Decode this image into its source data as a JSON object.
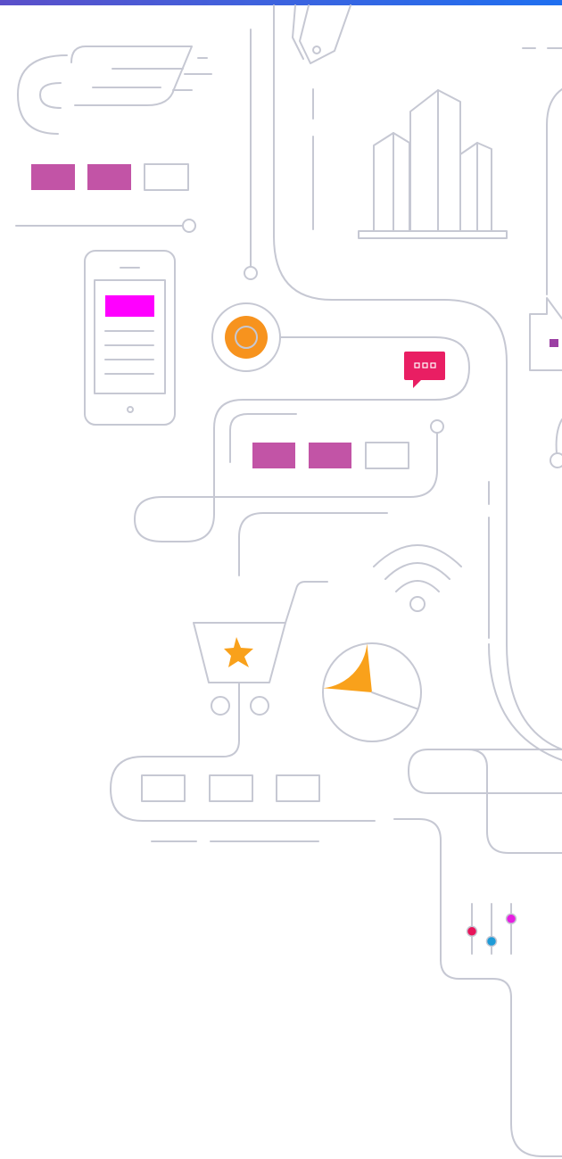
{
  "colors": {
    "line": "#c6c8d3",
    "top_bar_start": "#5b4fc9",
    "top_bar_end": "#1f6ff0",
    "magenta_block": "#c254a6",
    "phone_highlight": "#ff00ff",
    "orange": "#f7931e",
    "pie_slice": "#f9a11b",
    "chat_bubble": "#e91e63",
    "slider_knob_red": "#e8145a",
    "slider_knob_blue": "#1e9bd7",
    "slider_knob_magenta": "#e61fe0",
    "small_square": "#9b3fa3"
  },
  "icons": [
    "winged-speed-icon",
    "mobile-phone-icon",
    "city-buildings-icon",
    "chat-bubble-icon",
    "wifi-icon",
    "shopping-cart-icon",
    "star-icon",
    "pie-chart-icon",
    "sliders-icon",
    "price-tag-icon",
    "house-icon",
    "orange-target-icon"
  ],
  "pie": {
    "highlighted_fraction": 0.22
  },
  "sliders": {
    "levels": [
      0.45,
      0.25,
      0.7
    ]
  }
}
